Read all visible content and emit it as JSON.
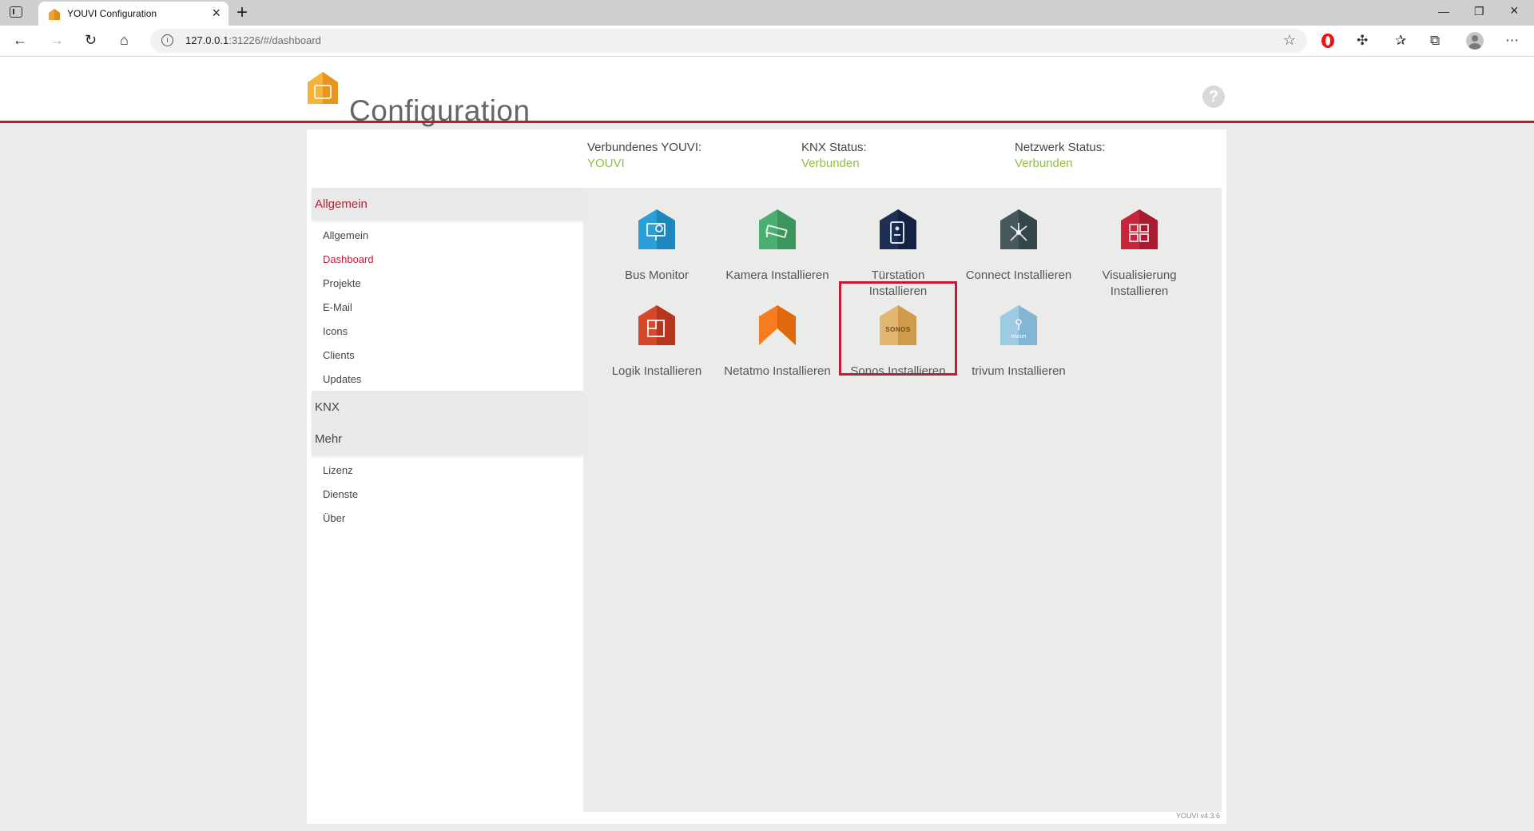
{
  "browser": {
    "tab_title": "YOUVI Configuration",
    "url_host": "127.0.0.1",
    "url_rest": ":31226/#/dashboard"
  },
  "app": {
    "title": "Configuration",
    "version": "YOUVI v4.3.6",
    "accent_color": "#c41a36",
    "status_ok_color": "#8ec03f"
  },
  "status": [
    {
      "label": "Verbundenes YOUVI:",
      "value": "YOUVI"
    },
    {
      "label": "KNX Status:",
      "value": "Verbunden"
    },
    {
      "label": "Netzwerk Status:",
      "value": "Verbunden"
    }
  ],
  "sidebar": {
    "sections": [
      {
        "label": "Allgemein"
      },
      {
        "label": "KNX"
      },
      {
        "label": "Mehr"
      }
    ],
    "allgemein_items": [
      "Allgemein",
      "Dashboard",
      "Projekte",
      "E-Mail",
      "Icons",
      "Clients",
      "Updates"
    ],
    "mehr_items": [
      "Lizenz",
      "Dienste",
      "Über"
    ]
  },
  "tiles": [
    {
      "label": "Bus Monitor",
      "icon": "bus-monitor-icon",
      "color": "#2a9fd8"
    },
    {
      "label": "Kamera Installieren",
      "icon": "camera-icon",
      "color": "#4caf72"
    },
    {
      "label": "Türstation Installieren",
      "icon": "door-station-icon",
      "color": "#1d2f55"
    },
    {
      "label": "Connect Installieren",
      "icon": "connect-icon",
      "color": "#3e4a4d"
    },
    {
      "label": "Visualisierung Installieren",
      "icon": "visualization-icon",
      "color": "#c41a36"
    },
    {
      "label": "Logik Installieren",
      "icon": "logic-icon",
      "color": "#d2442a"
    },
    {
      "label": "Netatmo Installieren",
      "icon": "netatmo-icon",
      "color": "#f57d1f"
    },
    {
      "label": "Sonos Installieren",
      "icon": "sonos-icon",
      "color": "#d9a960",
      "text": "SONOS"
    },
    {
      "label": "trivum Installieren",
      "icon": "trivum-icon",
      "color": "#8cc4e0",
      "text": "trivum"
    }
  ]
}
